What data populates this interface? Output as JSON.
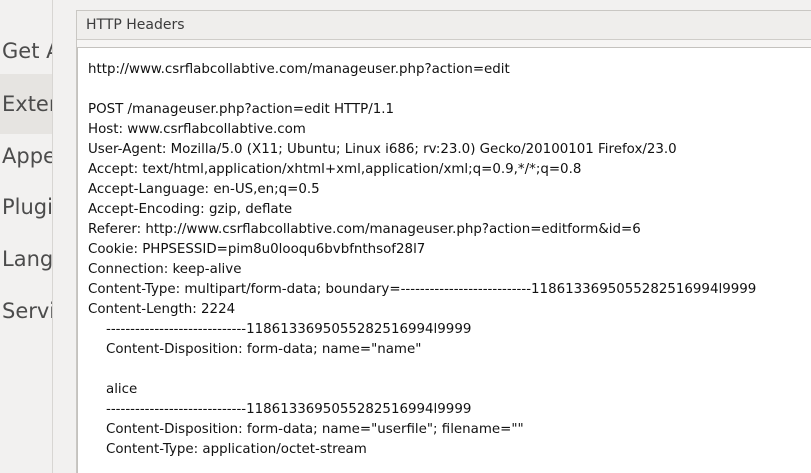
{
  "sidebar": {
    "items": [
      {
        "label": "Get A",
        "active": false
      },
      {
        "label": "Exten",
        "active": true
      },
      {
        "label": "Appe",
        "active": false
      },
      {
        "label": "Plugi",
        "active": false
      },
      {
        "label": "Langu",
        "active": false
      },
      {
        "label": "Servi",
        "active": false
      }
    ]
  },
  "panel": {
    "title": "HTTP Headers",
    "url_line": "http://www.csrflabcollabtive.com/manageuser.php?action=edit",
    "request_line": "POST /manageuser.php?action=edit HTTP/1.1",
    "headers": [
      "Host: www.csrflabcollabtive.com",
      "User-Agent: Mozilla/5.0 (X11; Ubuntu; Linux i686; rv:23.0) Gecko/20100101 Firefox/23.0",
      "Accept: text/html,application/xhtml+xml,application/xml;q=0.9,*/*;q=0.8",
      "Accept-Language: en-US,en;q=0.5",
      "Accept-Encoding: gzip, deflate",
      "Referer: http://www.csrflabcollabtive.com/manageuser.php?action=editform&id=6",
      "Cookie: PHPSESSID=pim8u0looqu6bvbfnthsof28l7",
      "Connection: keep-alive",
      "Content-Type: multipart/form-data; boundary=---------------------------1186133695055282516994l9999",
      "Content-Length: 2224"
    ],
    "body": [
      "-----------------------------1186133695055282516994l9999",
      "Content-Disposition: form-data; name=\"name\"",
      "",
      "alice",
      "-----------------------------1186133695055282516994l9999",
      "Content-Disposition: form-data; name=\"userfile\"; filename=\"\"",
      "Content-Type: application/octet-stream"
    ]
  }
}
